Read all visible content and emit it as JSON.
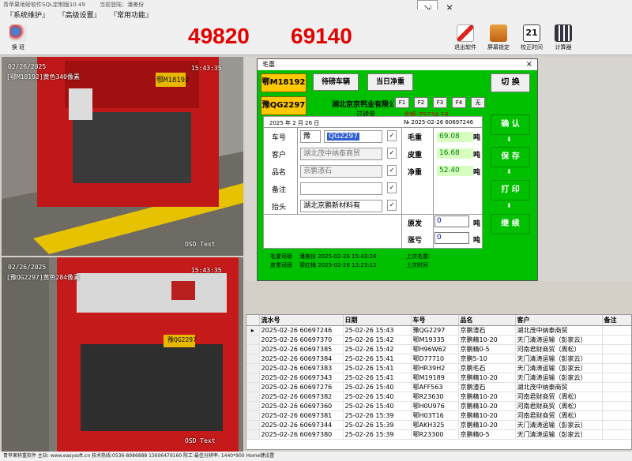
{
  "window": {
    "title": "青苹果地磅软件SQL定制版10.49",
    "login": "当前登陆：潘美份",
    "minimize_icon": "mouse-minimize-icon",
    "close_icon": "close-icon"
  },
  "menu": [
    "『系统维护』",
    "『高级设置』",
    "『常用功能』"
  ],
  "toolbar": {
    "shift_label": "换 班",
    "weight_1": "49820",
    "weight_2": "69140",
    "buttons": [
      {
        "label": "退出软件",
        "icon": "exit-icon"
      },
      {
        "label": "屏幕锁定",
        "icon": "lock-screen-icon"
      },
      {
        "label": "校正时间",
        "icon": "calendar-icon"
      },
      {
        "label": "计算器",
        "icon": "calculator-icon"
      }
    ]
  },
  "cameras": [
    {
      "date": "02/26/2025",
      "plate_caption": "[鄂M18192]黄色340像素",
      "time": "15:43:35",
      "plate": "鄂M18192",
      "watermark": "OSD Text"
    },
    {
      "date": "02/26/2025",
      "plate_caption": "[豫QG2297]黄色284像素",
      "time": "15:43:35",
      "plate": "豫QG2297",
      "watermark": "OSD Text"
    }
  ],
  "dialog": {
    "title": "毛重",
    "close": "×",
    "vehicle_1": "鄂M18192",
    "vehicle_2": "豫QG2297",
    "pending_button": "待磅车辆",
    "today_net_button": "当日净重",
    "switch_button": "切 换",
    "company": "湖北京京钙业有限公",
    "fkeys": [
      "F1",
      "F2",
      "F3",
      "F4",
      "无"
    ],
    "ticket_title": "过磅单",
    "balance": "余额:75234.16",
    "date_line": "2025 年 2 月 26 日",
    "ticket_no": "№  2025-02-26 60697246",
    "fields": {
      "plate_label": "车号",
      "plate_prefix": "豫",
      "plate_value": "QG2297",
      "customer_label": "客户",
      "customer_value": "湖北茂中纳泰商贸",
      "product_label": "品名",
      "product_value": "京鹏渣石",
      "remark_label": "备注",
      "remark_value": "",
      "header_label": "抬头",
      "header_value": "湖北京鹏新材料有"
    },
    "weights": {
      "gross_label": "毛重",
      "gross": "69.08",
      "tare_label": "皮重",
      "tare": "16.68",
      "net_label": "净重",
      "net": "52.40",
      "unit": "吨",
      "orig_label": "原发",
      "orig": "0",
      "loss_label": "涨亏",
      "loss": "0"
    },
    "side_buttons": [
      "确 认",
      "保 存",
      "打 印",
      "继 续"
    ],
    "footer": {
      "gross_weigher_label": "毛重司磅",
      "gross_weigher": "潘美份   2025-02-26 15:43:26",
      "tare_weigher_label": "皮重司磅",
      "tare_weigher": "梁红梅   2025-02-26 13:23:12",
      "last_gross_label": "上次毛重:",
      "last_tare_label": "上次时间"
    }
  },
  "grid": {
    "columns": [
      "流水号",
      "日期",
      "车号",
      "品名",
      "客户",
      "备注"
    ],
    "rows": [
      [
        "2025-02-26 60697246",
        "25-02-26 15:43",
        "豫QG2297",
        "京鹏渣石",
        "湖北茂中纳泰商贸",
        ""
      ],
      [
        "2025-02-26 60697370",
        "25-02-26 15:42",
        "鄂M19335",
        "京鹏精10-20",
        "天门清涛运输（彭家云）",
        ""
      ],
      [
        "2025-02-26 60697385",
        "25-02-26 15:42",
        "鄂H96W62",
        "京鹏精0-5",
        "河南君财商贸（周松）",
        ""
      ],
      [
        "2025-02-26 60697384",
        "25-02-26 15:41",
        "鄂D77710",
        "京鹏5-10",
        "天门清涛运输（彭家云）",
        ""
      ],
      [
        "2025-02-26 60697383",
        "25-02-26 15:41",
        "鄂HR39H2",
        "京鹏毛石",
        "天门清涛运输（彭家云）",
        ""
      ],
      [
        "2025-02-26 60697343",
        "25-02-26 15:41",
        "鄂M19189",
        "京鹏精10-20",
        "天门清涛运输（彭家云）",
        ""
      ],
      [
        "2025-02-26 60697276",
        "25-02-26 15:40",
        "鄂AFF563",
        "京鹏渣石",
        "湖北茂中纳泰商贸",
        ""
      ],
      [
        "2025-02-26 60697382",
        "25-02-26 15:40",
        "鄂R23630",
        "京鹏精10-20",
        "河南君财商贸（周松）",
        ""
      ],
      [
        "2025-02-26 60697360",
        "25-02-26 15:40",
        "鄂H0U976",
        "京鹏精10-20",
        "河南君财商贸（周松）",
        ""
      ],
      [
        "2025-02-26 60697381",
        "25-02-26 15:39",
        "鄂H03T16",
        "京鹏精10-20",
        "河南君财商贸（周松）",
        ""
      ],
      [
        "2025-02-26 60697344",
        "25-02-26 15:39",
        "鄂AKH325",
        "京鹏精10-20",
        "天门清涛运输（彭家云）",
        ""
      ],
      [
        "2025-02-26 60697380",
        "25-02-26 15:39",
        "鄂R23300",
        "京鹏精0-5",
        "天门清涛运输（彭家云）",
        ""
      ]
    ]
  },
  "status": "青苹果称重软件 主站: www.easysoft.cn    技术热线:0536-8986888 13606479160 陈工    最佳分辨率: 1440*900    Home键设置"
}
